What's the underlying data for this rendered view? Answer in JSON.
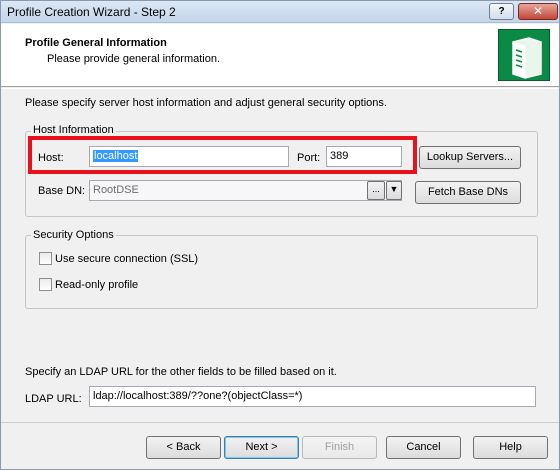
{
  "window": {
    "title": "Profile Creation Wizard - Step 2",
    "help_btn": "?",
    "close_btn": "✕"
  },
  "header": {
    "title": "Profile General Information",
    "subtitle": "Please provide general information."
  },
  "intro": "Please specify server host information and adjust general security options.",
  "host_group": {
    "label": "Host Information",
    "host_label": "Host:",
    "host_value": "localhost",
    "port_label": "Port:",
    "port_value": "389",
    "lookup_button": "Lookup Servers...",
    "base_dn_label": "Base DN:",
    "base_dn_value": "RootDSE",
    "ellipsis_button": "...",
    "dropdown_glyph": "▼",
    "fetch_button": "Fetch Base DNs"
  },
  "security_group": {
    "label": "Security Options",
    "ssl_label": "Use secure connection (SSL)",
    "ssl_checked": false,
    "readonly_label": "Read-only profile",
    "readonly_checked": false
  },
  "ldap": {
    "hint": "Specify an LDAP URL for the other fields to be filled based on it.",
    "label": "LDAP URL:",
    "value": "ldap://localhost:389/??one?(objectClass=*)"
  },
  "footer": {
    "back": "< Back",
    "next": "Next >",
    "finish": "Finish",
    "cancel": "Cancel",
    "help": "Help"
  },
  "colors": {
    "highlight": "#e8121c",
    "selection": "#3399ff"
  }
}
